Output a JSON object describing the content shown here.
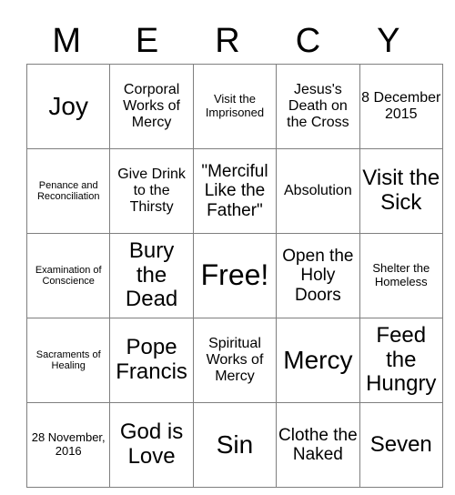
{
  "card": {
    "header_letters": [
      "M",
      "E",
      "R",
      "C",
      "Y"
    ],
    "rows": [
      [
        {
          "text": "Joy",
          "size": "xxl"
        },
        {
          "text": "Corporal Works of Mercy",
          "size": "m"
        },
        {
          "text": "Visit the Imprisoned",
          "size": "s"
        },
        {
          "text": "Jesus's Death on the Cross",
          "size": "m"
        },
        {
          "text": "8 December 2015",
          "size": "m"
        }
      ],
      [
        {
          "text": "Penance and Reconciliation",
          "size": "xs"
        },
        {
          "text": "Give Drink to the Thirsty",
          "size": "m"
        },
        {
          "text": "\"Merciful Like the Father\"",
          "size": "l"
        },
        {
          "text": "Absolution",
          "size": "m"
        },
        {
          "text": "Visit the Sick",
          "size": "xl"
        }
      ],
      [
        {
          "text": "Examination of Conscience",
          "size": "xs"
        },
        {
          "text": "Bury the Dead",
          "size": "xl"
        },
        {
          "text": "Free!",
          "size": "xxxl"
        },
        {
          "text": "Open the Holy Doors",
          "size": "l"
        },
        {
          "text": "Shelter the Homeless",
          "size": "s"
        }
      ],
      [
        {
          "text": "Sacraments of Healing",
          "size": "xs"
        },
        {
          "text": "Pope Francis",
          "size": "xl"
        },
        {
          "text": "Spiritual Works of Mercy",
          "size": "m"
        },
        {
          "text": "Mercy",
          "size": "xxl"
        },
        {
          "text": "Feed the Hungry",
          "size": "xl"
        }
      ],
      [
        {
          "text": "28 November, 2016",
          "size": "s"
        },
        {
          "text": "God is Love",
          "size": "xl"
        },
        {
          "text": "Sin",
          "size": "xxl"
        },
        {
          "text": "Clothe the Naked",
          "size": "l"
        },
        {
          "text": "Seven",
          "size": "xl"
        }
      ]
    ],
    "colors": {
      "border": "#7f7f7f",
      "text": "#000000",
      "background": "#ffffff"
    }
  }
}
